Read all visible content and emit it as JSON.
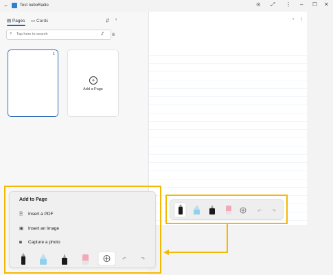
{
  "window": {
    "title": "Test nuboRadio",
    "back_glyph": "←",
    "controls": {
      "refresh": "⊙",
      "expand": "⤢",
      "more": "⋮",
      "minimize": "–",
      "maximize": "☐",
      "close": "✕"
    }
  },
  "sidebar": {
    "tabs": [
      {
        "label": "Pages",
        "icon": "pages-icon",
        "selected": true
      },
      {
        "label": "Cards",
        "icon": "cards-icon",
        "selected": false
      }
    ],
    "search": {
      "placeholder": "Tap here to search"
    },
    "pages": [
      {
        "number": "1"
      }
    ],
    "add_page_label": "Add a Page"
  },
  "page_nav": {
    "prev": "‹",
    "more": "⋮"
  },
  "popup": {
    "title": "Add to Page",
    "items": [
      {
        "label": "Insert a PDF",
        "icon": "pdf-file-icon"
      },
      {
        "label": "Insert an Image",
        "icon": "image-icon"
      },
      {
        "label": "Capture a photo",
        "icon": "camera-icon"
      }
    ]
  },
  "toolbar": {
    "tools": [
      {
        "name": "black-pen",
        "color": "#1a1a1a"
      },
      {
        "name": "blue-highlighter",
        "color": "#8fd0ec"
      },
      {
        "name": "fineliner",
        "color": "#1a1a1a"
      },
      {
        "name": "pink-eraser",
        "color": "#f4a7b6"
      }
    ],
    "add_glyph": "⊕",
    "undo_glyph": "↶",
    "redo_glyph": "↷"
  },
  "colors": {
    "accent": "#0f6cbd",
    "highlight": "#f5b800",
    "selected_border": "#2d6bb5"
  }
}
